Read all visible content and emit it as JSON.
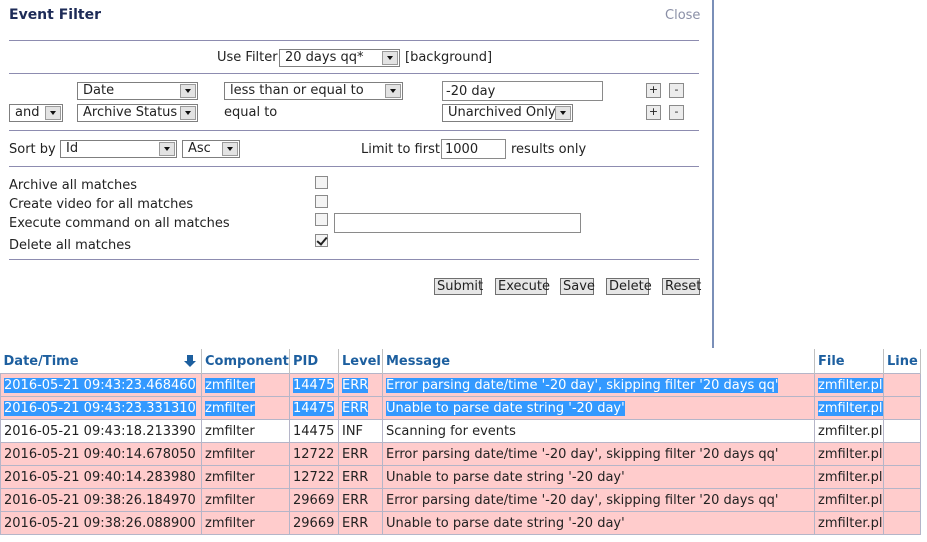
{
  "dialog": {
    "title": "Event Filter",
    "close_label": "Close",
    "use_filter_label": "Use Filter",
    "use_filter_value": "20 days qq*",
    "background_label": "[background]",
    "terms": [
      {
        "field": "Date",
        "operator": "less than or equal to",
        "value": "-20 day"
      },
      {
        "conjunction": "and",
        "field": "Archive Status",
        "operator": "equal to",
        "value": "Unarchived Only"
      }
    ],
    "plus_label": "+",
    "minus_label": "-",
    "sort_by_label": "Sort by",
    "sort_field": "Id",
    "sort_dir": "Asc",
    "limit_label": "Limit to first",
    "limit_value": "1000",
    "limit_suffix": "results only",
    "actions": {
      "archive": {
        "label": "Archive all matches",
        "checked": false
      },
      "video": {
        "label": "Create video for all matches",
        "checked": false
      },
      "execute": {
        "label": "Execute command on all matches",
        "checked": false,
        "command": ""
      },
      "delete": {
        "label": "Delete all matches",
        "checked": true
      }
    },
    "buttons": {
      "submit": "Submit",
      "execute": "Execute",
      "save": "Save",
      "delete": "Delete",
      "reset": "Reset"
    }
  },
  "log": {
    "columns": [
      "Date/Time",
      "Component",
      "PID",
      "Level",
      "Message",
      "File",
      "Line"
    ],
    "rows": [
      {
        "datetime": "2016-05-21 09:43:23.468460",
        "component": "zmfilter",
        "pid": "14475",
        "level": "ERR",
        "message": "Error parsing date/time '-20 day', skipping filter '20 days qq'",
        "file": "zmfilter.pl",
        "line": ""
      },
      {
        "datetime": "2016-05-21 09:43:23.331310",
        "component": "zmfilter",
        "pid": "14475",
        "level": "ERR",
        "message": "Unable to parse date string '-20 day'",
        "file": "zmfilter.pl",
        "line": ""
      },
      {
        "datetime": "2016-05-21 09:43:18.213390",
        "component": "zmfilter",
        "pid": "14475",
        "level": "INF",
        "message": "Scanning for events",
        "file": "zmfilter.pl",
        "line": ""
      },
      {
        "datetime": "2016-05-21 09:40:14.678050",
        "component": "zmfilter",
        "pid": "12722",
        "level": "ERR",
        "message": "Error parsing date/time '-20 day', skipping filter '20 days qq'",
        "file": "zmfilter.pl",
        "line": ""
      },
      {
        "datetime": "2016-05-21 09:40:14.283980",
        "component": "zmfilter",
        "pid": "12722",
        "level": "ERR",
        "message": "Unable to parse date string '-20 day'",
        "file": "zmfilter.pl",
        "line": ""
      },
      {
        "datetime": "2016-05-21 09:38:26.184970",
        "component": "zmfilter",
        "pid": "29669",
        "level": "ERR",
        "message": "Error parsing date/time '-20 day', skipping filter '20 days qq'",
        "file": "zmfilter.pl",
        "line": ""
      },
      {
        "datetime": "2016-05-21 09:38:26.088900",
        "component": "zmfilter",
        "pid": "29669",
        "level": "ERR",
        "message": "Unable to parse date string '-20 day'",
        "file": "zmfilter.pl",
        "line": ""
      }
    ]
  },
  "colors": {
    "error_row": "#ffcccc",
    "selection": "#3399ff",
    "header_text": "#1d5f9f"
  }
}
